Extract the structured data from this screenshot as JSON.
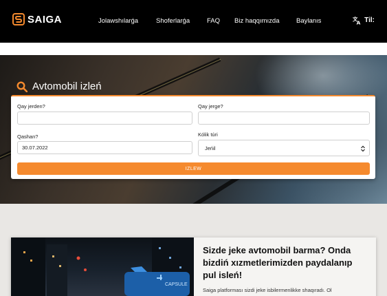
{
  "header": {
    "brand": "SAIGA",
    "nav": [
      "Jolawshılarǵa",
      "Shoferlarǵa",
      "FAQ",
      "Biz haqqımızda",
      "Baylanıs"
    ],
    "language_label": "Til:"
  },
  "search": {
    "title": "Avtomobil izleń",
    "from_label": "Qay jerden?",
    "from_value": "",
    "to_label": "Qay jerge?",
    "to_value": "",
    "date_label": "Qashan?",
    "date_value": "30.07.2022",
    "vehicle_label": "Kólik túri",
    "vehicle_value": "Jeńil",
    "submit_label": "IZLEW"
  },
  "promo": {
    "heading": "Sizde jeke avtomobil barma? Onda bizdiń xızmetlerimizden paydalanıp pul isleń!",
    "text": "Saiga platforması sizdi jeke isbilermenlikke shaqıradı. Ol",
    "taxi_sign": "CAPSULE"
  },
  "colors": {
    "accent": "#f58a2e",
    "header_bg": "#000000"
  },
  "icons": [
    "saiga-logo-icon",
    "translate-icon",
    "search-icon",
    "select-arrow-icon"
  ]
}
